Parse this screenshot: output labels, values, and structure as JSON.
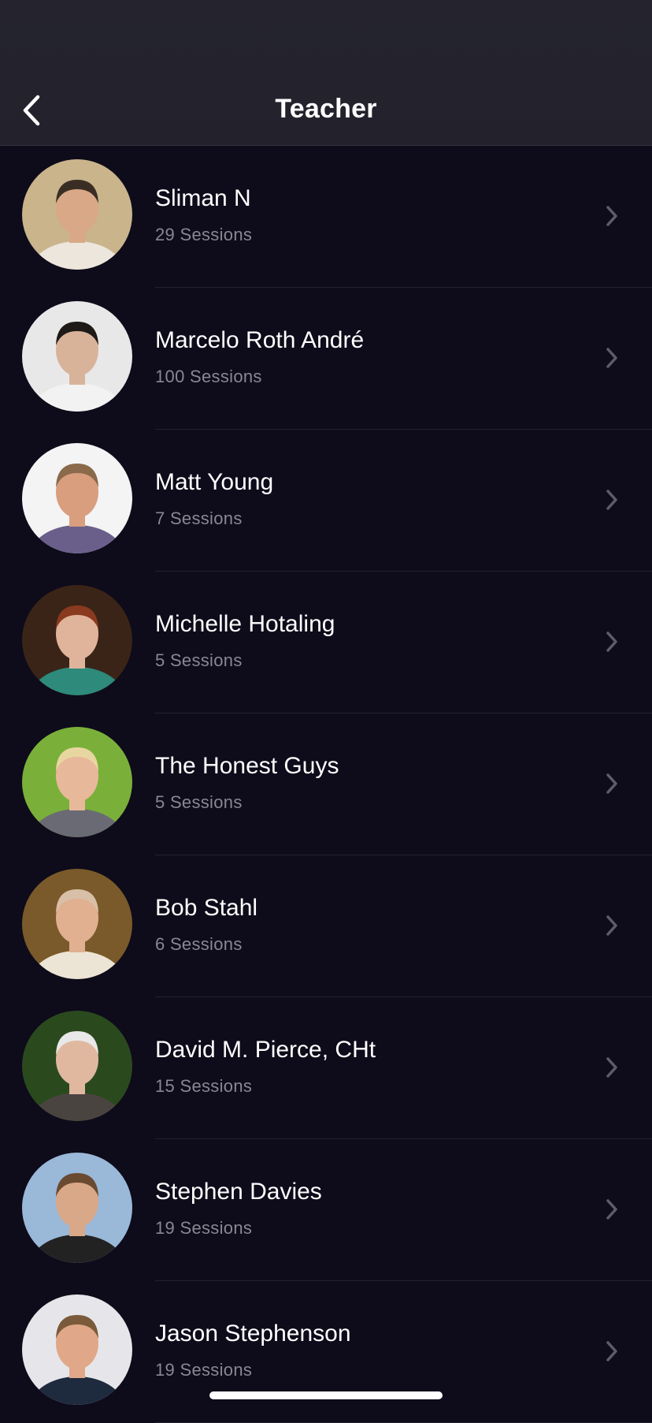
{
  "header": {
    "title": "Teacher",
    "back_icon": "chevron-left-icon"
  },
  "teachers": [
    {
      "name": "Sliman N",
      "sessions": "29 Sessions",
      "avatar": {
        "bg": "#c9b48c",
        "skin": "#d9a887",
        "hair": "#3a2e24",
        "shirt": "#ece6dc"
      }
    },
    {
      "name": "Marcelo Roth André",
      "sessions": "100 Sessions",
      "avatar": {
        "bg": "#e8e8e8",
        "skin": "#d8b39a",
        "hair": "#1e1a18",
        "shirt": "#f2f2f2"
      }
    },
    {
      "name": "Matt Young",
      "sessions": "7 Sessions",
      "avatar": {
        "bg": "#f4f4f4",
        "skin": "#d99e7e",
        "hair": "#8a6a4a",
        "shirt": "#6a5f8a"
      }
    },
    {
      "name": "Michelle Hotaling",
      "sessions": "5 Sessions",
      "avatar": {
        "bg": "#3a2418",
        "skin": "#e0b49a",
        "hair": "#8a3a1e",
        "shirt": "#2e8a7a"
      }
    },
    {
      "name": "The Honest Guys",
      "sessions": "5 Sessions",
      "avatar": {
        "bg": "#7ab03a",
        "skin": "#e8b89a",
        "hair": "#e8d6a0",
        "shirt": "#6a6a74"
      }
    },
    {
      "name": "Bob Stahl",
      "sessions": "6 Sessions",
      "avatar": {
        "bg": "#7a5a2a",
        "skin": "#e0b090",
        "hair": "#d8c0a8",
        "shirt": "#ece4d4"
      }
    },
    {
      "name": "David M. Pierce, CHt",
      "sessions": "15 Sessions",
      "avatar": {
        "bg": "#2a4a1e",
        "skin": "#e0b8a0",
        "hair": "#e8e8e8",
        "shirt": "#4a4440"
      }
    },
    {
      "name": "Stephen Davies",
      "sessions": "19 Sessions",
      "avatar": {
        "bg": "#9ab8d8",
        "skin": "#d8a888",
        "hair": "#6a4a30",
        "shirt": "#222222"
      }
    },
    {
      "name": "Jason Stephenson",
      "sessions": "19 Sessions",
      "avatar": {
        "bg": "#e6e6ea",
        "skin": "#e0a888",
        "hair": "#7a5a3a",
        "shirt": "#1e2a3e"
      }
    }
  ],
  "row_icon": "chevron-right-icon",
  "colors": {
    "background": "#0e0b1a",
    "navbar": "#24232d",
    "subtitle": "#8a8794",
    "chevron": "#5f5c6a"
  }
}
